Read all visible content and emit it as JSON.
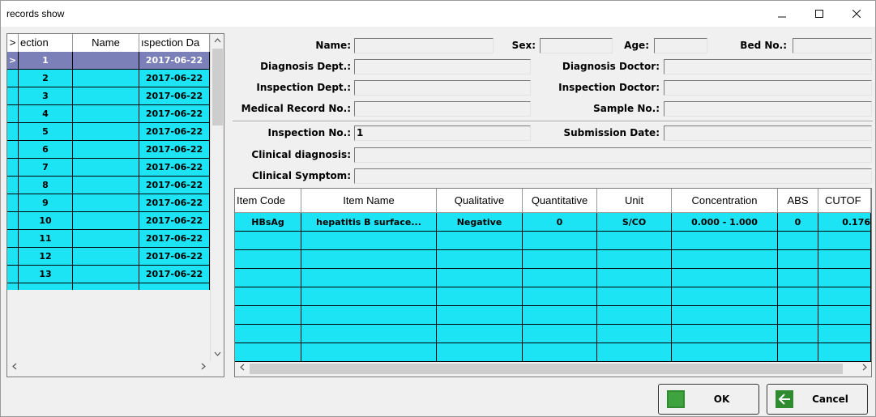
{
  "window": {
    "title": "records show"
  },
  "records": {
    "columns": [
      ">",
      "ection",
      "Name",
      "ıspection Da"
    ],
    "rows": [
      {
        "no": "1",
        "name": "",
        "date": "2017-06-22"
      },
      {
        "no": "2",
        "name": "",
        "date": "2017-06-22"
      },
      {
        "no": "3",
        "name": "",
        "date": "2017-06-22"
      },
      {
        "no": "4",
        "name": "",
        "date": "2017-06-22"
      },
      {
        "no": "5",
        "name": "",
        "date": "2017-06-22"
      },
      {
        "no": "6",
        "name": "",
        "date": "2017-06-22"
      },
      {
        "no": "7",
        "name": "",
        "date": "2017-06-22"
      },
      {
        "no": "8",
        "name": "",
        "date": "2017-06-22"
      },
      {
        "no": "9",
        "name": "",
        "date": "2017-06-22"
      },
      {
        "no": "10",
        "name": "",
        "date": "2017-06-22"
      },
      {
        "no": "11",
        "name": "",
        "date": "2017-06-22"
      },
      {
        "no": "12",
        "name": "",
        "date": "2017-06-22"
      },
      {
        "no": "13",
        "name": "",
        "date": "2017-06-22"
      }
    ],
    "selected_indicator": ">"
  },
  "form": {
    "name_label": "Name:",
    "name_value": "",
    "sex_label": "Sex:",
    "sex_value": "",
    "age_label": "Age:",
    "age_value": "",
    "bed_label": "Bed No.:",
    "bed_value": "",
    "diag_dept_label": "Diagnosis Dept.:",
    "diag_dept_value": "",
    "diag_doctor_label": "Diagnosis Doctor:",
    "diag_doctor_value": "",
    "insp_dept_label": "Inspection Dept.:",
    "insp_dept_value": "",
    "insp_doctor_label": "Inspection Doctor:",
    "insp_doctor_value": "",
    "mrn_label": "Medical Record No.:",
    "mrn_value": "",
    "sample_label": "Sample No.:",
    "sample_value": "",
    "insp_no_label": "Inspection No.:",
    "insp_no_value": "1",
    "submission_label": "Submission Date:",
    "submission_value": "",
    "clin_diag_label": "Clinical diagnosis:",
    "clin_diag_value": "",
    "clin_symptom_label": "Clinical Symptom:",
    "clin_symptom_value": ""
  },
  "results": {
    "columns": [
      "Item Code",
      "Item Name",
      "Qualitative",
      "Quantitative",
      "Unit",
      "Concentration",
      "ABS",
      "CUTOF"
    ],
    "rows": [
      {
        "code": "HBsAg",
        "name": "hepatitis B surface...",
        "qualitative": "Negative",
        "quantitative": "0",
        "unit": "S/CO",
        "concentration": "0.000 - 1.000",
        "abs": "0",
        "cutoff": "0.176"
      }
    ]
  },
  "buttons": {
    "ok": "OK",
    "cancel": "Cancel"
  },
  "colors": {
    "row_bg": "#1de4f4",
    "selected_bg": "#7b80b9",
    "ok_icon": "#2e8b2e",
    "cancel_icon": "#2e8b2e"
  }
}
